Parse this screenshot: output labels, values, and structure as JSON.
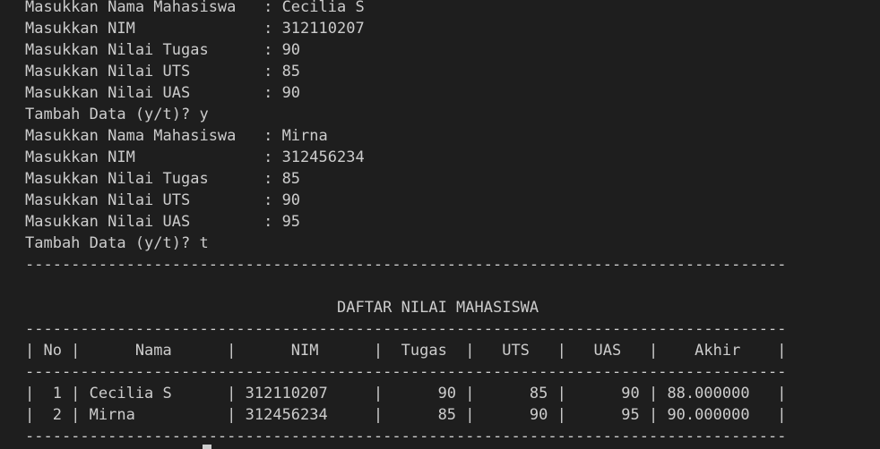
{
  "terminal": {
    "input_lines": [
      "Masukkan Nama Mahasiswa   : Cecilia S",
      "Masukkan NIM              : 312110207",
      "Masukkan Nilai Tugas      : 90",
      "Masukkan Nilai UTS        : 85",
      "Masukkan Nilai UAS        : 90",
      "Tambah Data (y/t)? y",
      "Masukkan Nama Mahasiswa   : Mirna",
      "Masukkan NIM              : 312456234",
      "Masukkan Nilai Tugas      : 85",
      "Masukkan Nilai UTS        : 90",
      "Masukkan Nilai UAS        : 95",
      "Tambah Data (y/t)? t"
    ],
    "separator": "-----------------------------------------------------------------------------------",
    "table_title": "                                  DAFTAR NILAI MAHASISWA",
    "table_header": "| No |      Nama      |      NIM      |  Tugas  |   UTS   |   UAS   |    Akhir    |",
    "table_rows": [
      "|  1 | Cecilia S      | 312110207     |      90 |      85 |      90 | 88.000000   |",
      "|  2 | Mirna          | 312456234     |      85 |      90 |      95 | 90.000000   |"
    ]
  },
  "colors": {
    "background": "#1e1e1e",
    "text": "#cccccc"
  }
}
